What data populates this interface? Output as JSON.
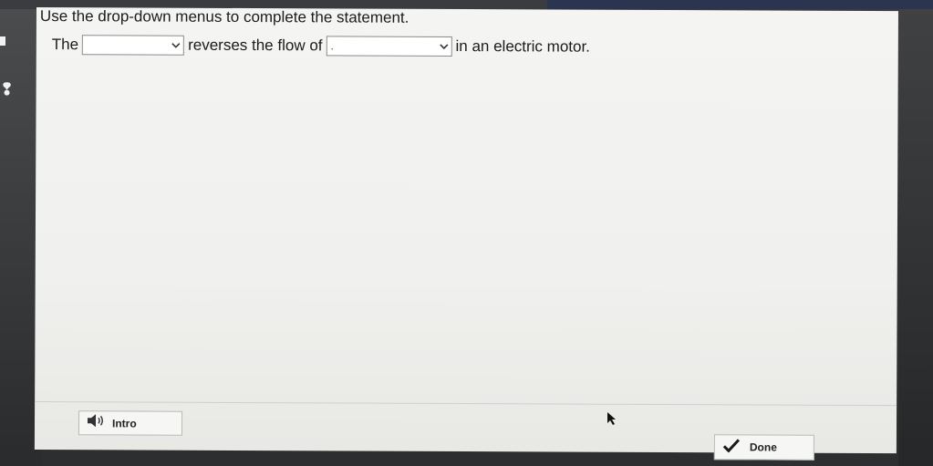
{
  "question": {
    "instruction": "Use the drop-down menus to complete the statement.",
    "part1": "The",
    "part2": "reverses the flow of",
    "part3": "in an electric motor."
  },
  "dropdowns": [
    {
      "selected": ""
    },
    {
      "selected": "."
    }
  ],
  "buttons": {
    "intro_label": "Intro",
    "done_label": "Done"
  },
  "icons": {
    "speaker": "speaker-icon",
    "check": "checkmark-icon",
    "chevron": "chevron-down-icon"
  },
  "colors": {
    "panel": "#f0f0ee",
    "text": "#1c1c1c",
    "checkmark": "#1a1a1a"
  }
}
